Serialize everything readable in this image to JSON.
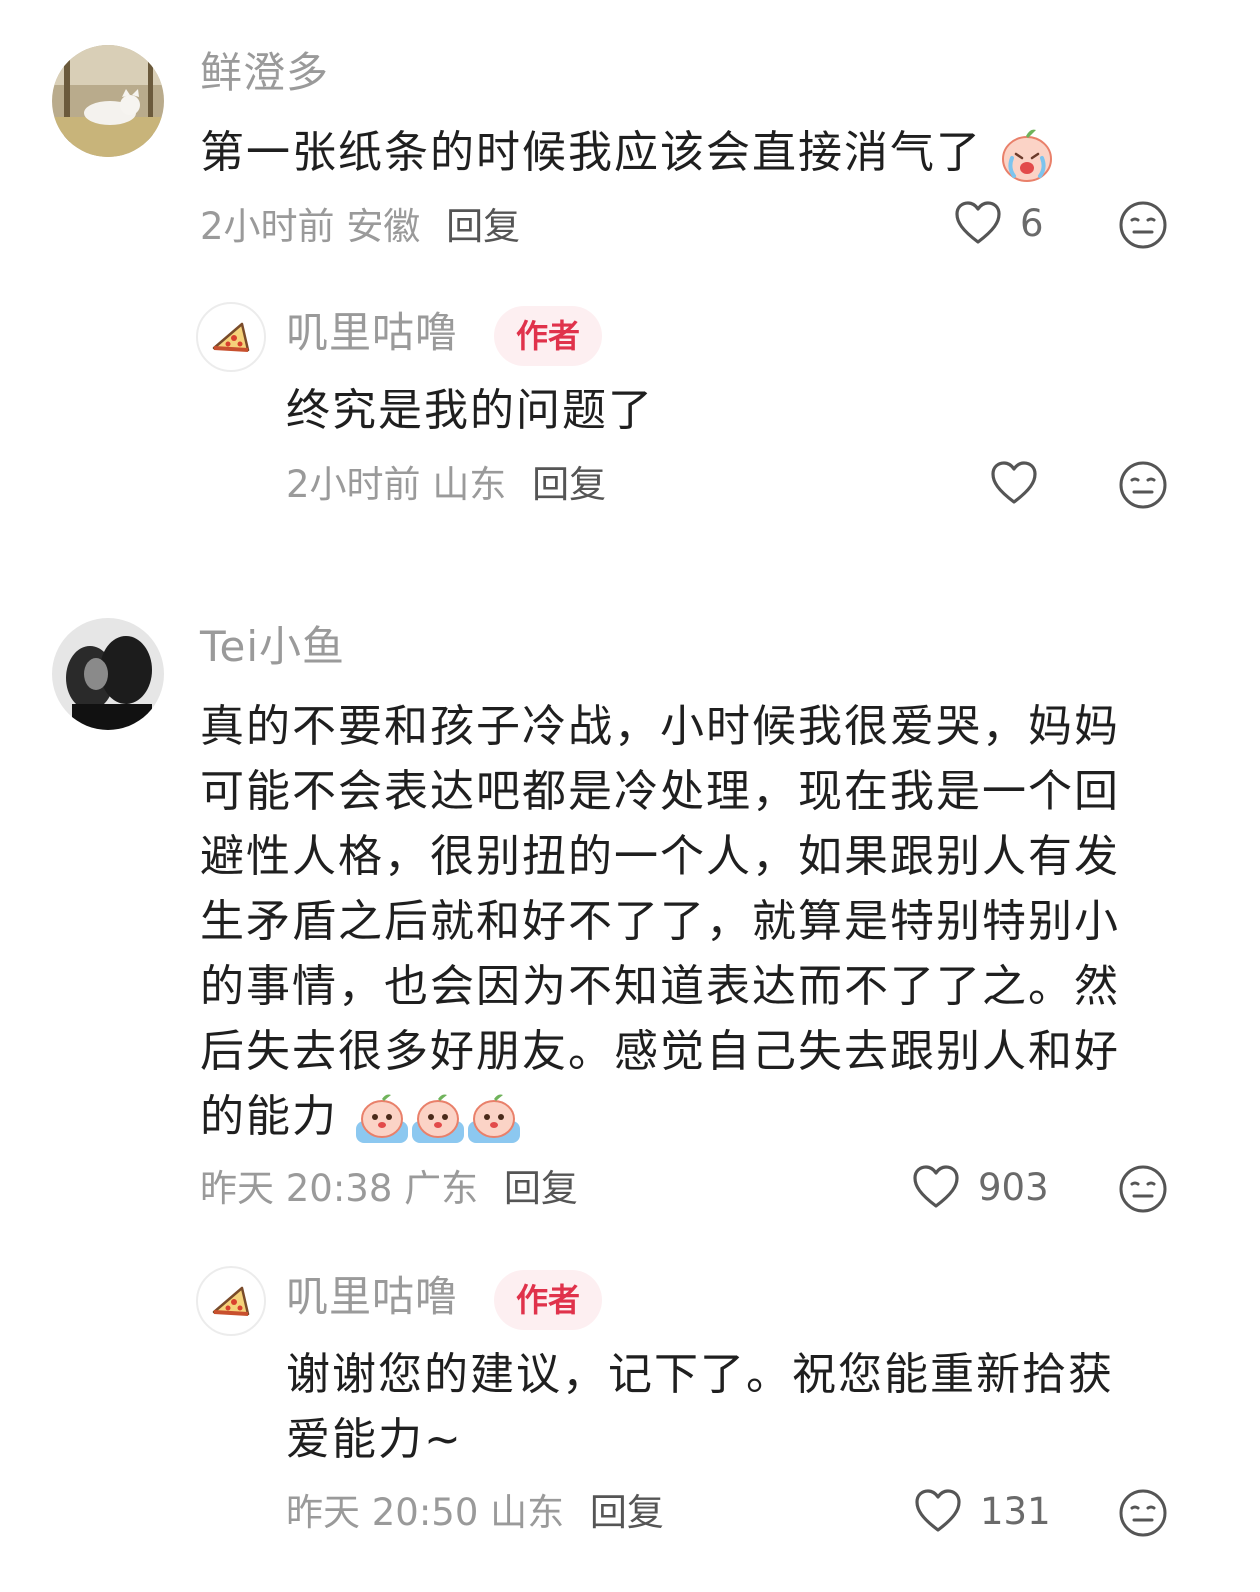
{
  "comments": [
    {
      "username": "鲜澄多",
      "text": "第一张纸条的时候我应该会直接消气了",
      "time": "2小时前",
      "location": "安徽",
      "reply_label": "回复",
      "likes": "6",
      "reply": {
        "username": "叽里咕噜",
        "badge": "作者",
        "text": "终究是我的问题了",
        "time": "2小时前",
        "location": "山东",
        "reply_label": "回复"
      }
    },
    {
      "username": "Tei小鱼",
      "text_lines": [
        "真的不要和孩子冷战，小时候我很爱哭，妈妈",
        "可能不会表达吧都是冷处理，现在我是一个回",
        "避性人格，很别扭的一个人，如果跟别人有发",
        "生矛盾之后就和好不了了，就算是特别特别小",
        "的事情，也会因为不知道表达而不了了之。然",
        "后失去很多好朋友。感觉自己失去跟别人和好",
        "的能力"
      ],
      "time": "昨天 20:38",
      "location": "广东",
      "reply_label": "回复",
      "likes": "903",
      "reply": {
        "username": "叽里咕噜",
        "badge": "作者",
        "text_lines": [
          "谢谢您的建议，记下了。祝您能重新拾获",
          "爱能力~"
        ],
        "time": "昨天 20:50",
        "location": "山东",
        "reply_label": "回复",
        "likes": "131"
      }
    }
  ],
  "icons": {
    "like": "heart-outline-icon",
    "emoji": "neutral-face-icon",
    "crying_sticker": "crying-peach-sticker"
  },
  "colors": {
    "author_badge_bg": "#fdeff1",
    "author_badge_text": "#e0324b",
    "meta_text": "#9a9a9a"
  }
}
